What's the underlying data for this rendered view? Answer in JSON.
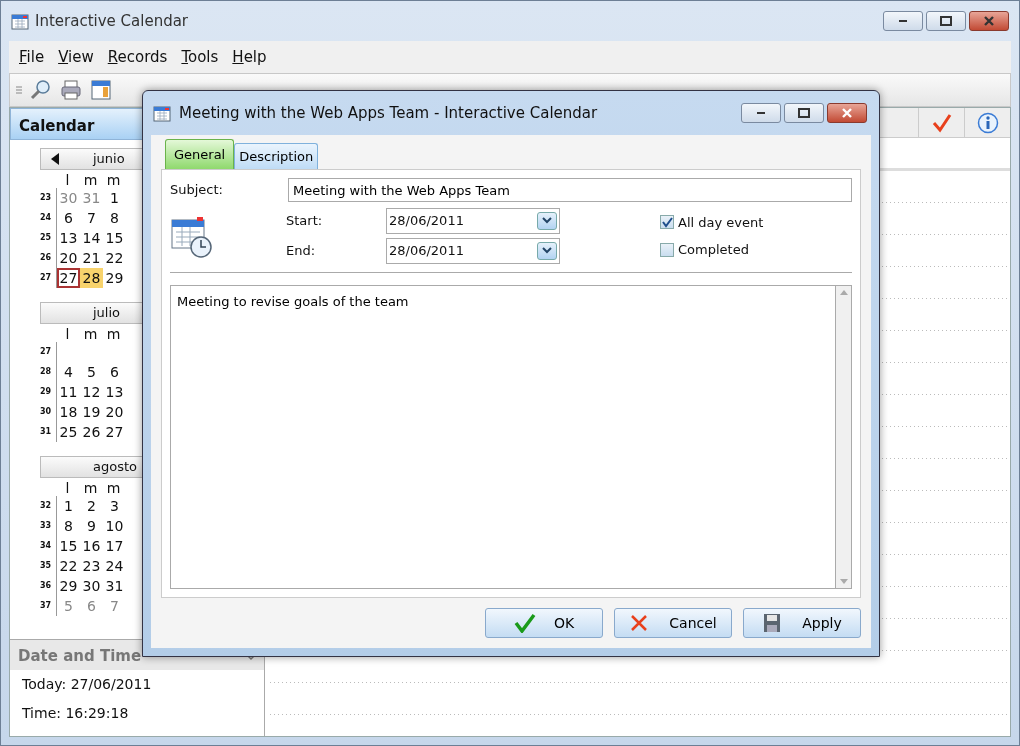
{
  "window": {
    "title": "Interactive Calendar"
  },
  "menu": [
    "File",
    "View",
    "Records",
    "Tools",
    "Help"
  ],
  "sidebar": {
    "title": "Calendar",
    "months": [
      {
        "header": "junio",
        "weekdays": [
          "l",
          "m",
          "m"
        ],
        "weeks": [
          {
            "week": "23",
            "days": [
              {
                "text": "30",
                "muted": true,
                "today": false,
                "selected": false
              },
              {
                "text": "31",
                "muted": true,
                "today": false,
                "selected": false
              },
              {
                "text": "1",
                "muted": false,
                "today": false,
                "selected": false
              }
            ]
          },
          {
            "week": "24",
            "days": [
              {
                "text": "6",
                "muted": false,
                "today": false,
                "selected": false
              },
              {
                "text": "7",
                "muted": false,
                "today": false,
                "selected": false
              },
              {
                "text": "8",
                "muted": false,
                "today": false,
                "selected": false
              }
            ]
          },
          {
            "week": "25",
            "days": [
              {
                "text": "13",
                "muted": false,
                "today": false,
                "selected": false
              },
              {
                "text": "14",
                "muted": false,
                "today": false,
                "selected": false
              },
              {
                "text": "15",
                "muted": false,
                "today": false,
                "selected": false
              }
            ]
          },
          {
            "week": "26",
            "days": [
              {
                "text": "20",
                "muted": false,
                "today": false,
                "selected": false
              },
              {
                "text": "21",
                "muted": false,
                "today": false,
                "selected": false
              },
              {
                "text": "22",
                "muted": false,
                "today": false,
                "selected": false
              }
            ]
          },
          {
            "week": "27",
            "days": [
              {
                "text": "27",
                "muted": false,
                "today": true,
                "selected": false
              },
              {
                "text": "28",
                "muted": false,
                "today": false,
                "selected": true
              },
              {
                "text": "29",
                "muted": false,
                "today": false,
                "selected": false
              }
            ]
          }
        ]
      },
      {
        "header": "julio",
        "weekdays": [
          "l",
          "m",
          "m"
        ],
        "weeks": [
          {
            "week": "27"
          },
          {
            "week": "28",
            "days": [
              {
                "text": "4",
                "muted": false,
                "today": false,
                "selected": false
              },
              {
                "text": "5",
                "muted": false,
                "today": false,
                "selected": false
              },
              {
                "text": "6",
                "muted": false,
                "today": false,
                "selected": false
              }
            ]
          },
          {
            "week": "29",
            "days": [
              {
                "text": "11",
                "muted": false,
                "today": false,
                "selected": false
              },
              {
                "text": "12",
                "muted": false,
                "today": false,
                "selected": false
              },
              {
                "text": "13",
                "muted": false,
                "today": false,
                "selected": false
              }
            ]
          },
          {
            "week": "30",
            "days": [
              {
                "text": "18",
                "muted": false,
                "today": false,
                "selected": false
              },
              {
                "text": "19",
                "muted": false,
                "today": false,
                "selected": false
              },
              {
                "text": "20",
                "muted": false,
                "today": false,
                "selected": false
              }
            ]
          },
          {
            "week": "31",
            "days": [
              {
                "text": "25",
                "muted": false,
                "today": false,
                "selected": false
              },
              {
                "text": "26",
                "muted": false,
                "today": false,
                "selected": false
              },
              {
                "text": "27",
                "muted": false,
                "today": false,
                "selected": false
              }
            ]
          }
        ]
      },
      {
        "header": "agosto",
        "weekdays": [
          "l",
          "m",
          "m"
        ],
        "weeks": [
          {
            "week": "32",
            "days": [
              {
                "text": "1",
                "muted": false,
                "today": false,
                "selected": false
              },
              {
                "text": "2",
                "muted": false,
                "today": false,
                "selected": false
              },
              {
                "text": "3",
                "muted": false,
                "today": false,
                "selected": false
              }
            ]
          },
          {
            "week": "33",
            "days": [
              {
                "text": "8",
                "muted": false,
                "today": false,
                "selected": false
              },
              {
                "text": "9",
                "muted": false,
                "today": false,
                "selected": false
              },
              {
                "text": "10",
                "muted": false,
                "today": false,
                "selected": false
              }
            ]
          },
          {
            "week": "34",
            "days": [
              {
                "text": "15",
                "muted": false,
                "today": false,
                "selected": false
              },
              {
                "text": "16",
                "muted": false,
                "today": false,
                "selected": false
              },
              {
                "text": "17",
                "muted": false,
                "today": false,
                "selected": false
              }
            ]
          },
          {
            "week": "35",
            "days": [
              {
                "text": "22",
                "muted": false,
                "today": false,
                "selected": false
              },
              {
                "text": "23",
                "muted": false,
                "today": false,
                "selected": false
              },
              {
                "text": "24",
                "muted": false,
                "today": false,
                "selected": false
              }
            ]
          },
          {
            "week": "36",
            "days": [
              {
                "text": "29",
                "muted": false,
                "today": false,
                "selected": false
              },
              {
                "text": "30",
                "muted": false,
                "today": false,
                "selected": false
              },
              {
                "text": "31",
                "muted": false,
                "today": false,
                "selected": false
              }
            ]
          },
          {
            "week": "37",
            "days": [
              {
                "text": "5",
                "muted": true,
                "today": false,
                "selected": false
              },
              {
                "text": "6",
                "muted": true,
                "today": false,
                "selected": false
              },
              {
                "text": "7",
                "muted": true,
                "today": false,
                "selected": false
              }
            ]
          }
        ]
      }
    ]
  },
  "date_time": {
    "title": "Date and Time",
    "lines": [
      "Today: 27/06/2011",
      "Time: 16:29:18"
    ]
  },
  "dialog": {
    "title": "Meeting with the Web Apps Team - Interactive Calendar",
    "tabs": [
      {
        "label": "General",
        "selected": true
      },
      {
        "label": "Description",
        "selected": false
      }
    ],
    "subject": {
      "label": "Subject:",
      "value": "Meeting with the Web Apps Team"
    },
    "dates": [
      {
        "label": "Start:",
        "value": "28/06/2011"
      },
      {
        "label": "End:",
        "value": "28/06/2011"
      }
    ],
    "checkboxes": [
      {
        "label": "All day event",
        "checked": true
      },
      {
        "label": "Completed",
        "checked": false
      }
    ],
    "notes": "Meeting to revise goals of the team",
    "buttons": [
      {
        "label": "OK",
        "kind": "ok"
      },
      {
        "label": "Cancel",
        "kind": "cancel"
      },
      {
        "label": "Apply",
        "kind": "apply"
      }
    ]
  }
}
